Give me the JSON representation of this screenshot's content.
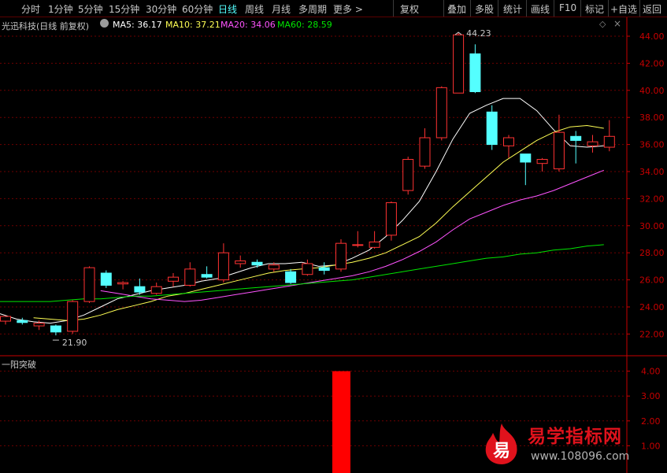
{
  "toolbar": {
    "periods": [
      "分时",
      "1分钟",
      "5分钟",
      "15分钟",
      "30分钟",
      "60分钟",
      "日线",
      "周线",
      "月线",
      "多周期",
      "更多 >"
    ],
    "active_period": "日线",
    "actions": [
      "复权",
      "叠加",
      "多股",
      "统计",
      "画线",
      "F10",
      "标记",
      "+自选",
      "返回"
    ]
  },
  "legend": {
    "stock": "光迅科技(日线 前复权)",
    "ma5": "MA5: 36.17",
    "ma10": "MA10: 37.21",
    "ma20": "MA20: 34.06",
    "ma60": "MA60: 28.59"
  },
  "indicator_title": "一阳突破",
  "watermark": {
    "logo_char": "易",
    "title": "易学指标网",
    "url": "www.108096.com"
  },
  "colors": {
    "up": "#ff3232",
    "down": "#54ffff",
    "ma5": "#ffffff",
    "ma10": "#ffff54",
    "ma20": "#ff54ff",
    "ma60": "#00e600",
    "axis": "#c80000",
    "grid": "#6e0000",
    "signal_bar": "#ff0000"
  },
  "chart_data": [
    {
      "type": "candlestick",
      "title": "光迅科技(日线 前复权)",
      "ylim": [
        21.0,
        45.0
      ],
      "yticks": [
        22.0,
        24.0,
        26.0,
        28.0,
        30.0,
        32.0,
        34.0,
        36.0,
        38.0,
        40.0,
        42.0,
        44.0
      ],
      "candles": [
        {
          "o": 22.95,
          "h": 23.2,
          "l": 22.7,
          "c": 23.3
        },
        {
          "o": 23.0,
          "h": 23.2,
          "l": 22.7,
          "c": 22.85
        },
        {
          "o": 22.6,
          "h": 23.0,
          "l": 22.3,
          "c": 22.8
        },
        {
          "o": 22.6,
          "h": 22.7,
          "l": 21.9,
          "c": 22.15
        },
        {
          "o": 22.2,
          "h": 24.5,
          "l": 22.0,
          "c": 24.4
        },
        {
          "o": 24.4,
          "h": 27.0,
          "l": 24.3,
          "c": 26.9
        },
        {
          "o": 26.5,
          "h": 26.7,
          "l": 25.4,
          "c": 25.6
        },
        {
          "o": 25.7,
          "h": 25.9,
          "l": 25.3,
          "c": 25.8
        },
        {
          "o": 25.5,
          "h": 26.1,
          "l": 24.9,
          "c": 25.1
        },
        {
          "o": 25.0,
          "h": 25.8,
          "l": 24.9,
          "c": 25.5
        },
        {
          "o": 25.9,
          "h": 26.5,
          "l": 25.5,
          "c": 26.2
        },
        {
          "o": 25.6,
          "h": 27.3,
          "l": 25.5,
          "c": 26.8
        },
        {
          "o": 26.4,
          "h": 27.0,
          "l": 26.1,
          "c": 26.2
        },
        {
          "o": 26.0,
          "h": 28.7,
          "l": 25.8,
          "c": 28.0
        },
        {
          "o": 27.2,
          "h": 27.8,
          "l": 26.9,
          "c": 27.4
        },
        {
          "o": 27.3,
          "h": 27.5,
          "l": 26.9,
          "c": 27.1
        },
        {
          "o": 26.8,
          "h": 27.3,
          "l": 26.6,
          "c": 27.1
        },
        {
          "o": 26.6,
          "h": 26.8,
          "l": 25.7,
          "c": 25.8
        },
        {
          "o": 26.4,
          "h": 27.5,
          "l": 26.3,
          "c": 27.2
        },
        {
          "o": 26.9,
          "h": 27.3,
          "l": 26.4,
          "c": 26.7
        },
        {
          "o": 26.8,
          "h": 29.0,
          "l": 26.6,
          "c": 28.7
        },
        {
          "o": 28.6,
          "h": 29.6,
          "l": 28.4,
          "c": 28.6
        },
        {
          "o": 28.4,
          "h": 29.6,
          "l": 28.3,
          "c": 28.8
        },
        {
          "o": 29.3,
          "h": 31.8,
          "l": 28.9,
          "c": 31.7
        },
        {
          "o": 32.6,
          "h": 35.1,
          "l": 32.3,
          "c": 34.9
        },
        {
          "o": 34.4,
          "h": 37.2,
          "l": 34.2,
          "c": 36.5
        },
        {
          "o": 36.5,
          "h": 40.3,
          "l": 36.3,
          "c": 40.2
        },
        {
          "o": 39.8,
          "h": 44.23,
          "l": 39.8,
          "c": 44.1
        },
        {
          "o": 42.7,
          "h": 43.4,
          "l": 39.8,
          "c": 39.9
        },
        {
          "o": 38.4,
          "h": 38.9,
          "l": 35.6,
          "c": 36.0
        },
        {
          "o": 35.9,
          "h": 36.7,
          "l": 35.0,
          "c": 36.5
        },
        {
          "o": 35.3,
          "h": 35.3,
          "l": 33.0,
          "c": 34.7
        },
        {
          "o": 34.6,
          "h": 35.0,
          "l": 34.0,
          "c": 34.9
        },
        {
          "o": 34.2,
          "h": 38.2,
          "l": 34.0,
          "c": 36.9
        },
        {
          "o": 36.6,
          "h": 37.0,
          "l": 34.6,
          "c": 36.3
        },
        {
          "o": 35.9,
          "h": 36.7,
          "l": 35.4,
          "c": 36.2
        },
        {
          "o": 35.8,
          "h": 37.8,
          "l": 35.5,
          "c": 36.6
        }
      ],
      "annotations": [
        {
          "label": "44.23",
          "value": 44.23,
          "candle": 27
        },
        {
          "label": "21.90",
          "value": 21.9,
          "candle": 3
        }
      ],
      "series": [
        {
          "name": "MA5",
          "values": [
            23.5,
            23.1,
            22.9,
            22.8,
            23.0,
            23.4,
            24.0,
            24.6,
            24.9,
            25.2,
            25.4,
            25.6,
            25.9,
            26.1,
            26.5,
            26.9,
            27.2,
            27.2,
            27.3,
            27.0,
            27.1,
            27.6,
            28.2,
            29.2,
            30.4,
            31.8,
            34.0,
            36.4,
            38.3,
            38.9,
            39.4,
            39.4,
            38.5,
            37.1,
            35.9,
            35.8,
            35.9
          ]
        },
        {
          "name": "MA10",
          "values": [
            null,
            null,
            23.2,
            23.1,
            23.0,
            23.1,
            23.4,
            23.8,
            24.1,
            24.4,
            24.8,
            25.0,
            25.3,
            25.6,
            25.9,
            26.2,
            26.5,
            26.7,
            26.8,
            26.9,
            27.1,
            27.3,
            27.6,
            28.0,
            28.6,
            29.2,
            30.2,
            31.4,
            32.5,
            33.6,
            34.7,
            35.5,
            36.3,
            36.9,
            37.3,
            37.4,
            37.2
          ]
        },
        {
          "name": "MA20",
          "values": [
            null,
            null,
            null,
            null,
            null,
            null,
            25.2,
            25.0,
            24.8,
            24.6,
            24.5,
            24.4,
            24.5,
            24.7,
            24.9,
            25.1,
            25.3,
            25.5,
            25.7,
            25.9,
            26.1,
            26.3,
            26.6,
            27.0,
            27.5,
            28.1,
            28.8,
            29.7,
            30.5,
            31.0,
            31.5,
            31.9,
            32.2,
            32.6,
            33.1,
            33.6,
            34.1
          ]
        },
        {
          "name": "MA60",
          "values": [
            24.4,
            24.4,
            24.4,
            24.4,
            24.5,
            24.6,
            24.6,
            24.7,
            24.8,
            24.8,
            24.9,
            25.0,
            25.1,
            25.2,
            25.3,
            25.4,
            25.5,
            25.6,
            25.7,
            25.8,
            25.9,
            26.0,
            26.2,
            26.4,
            26.6,
            26.8,
            27.0,
            27.2,
            27.4,
            27.6,
            27.7,
            27.9,
            28.0,
            28.2,
            28.3,
            28.5,
            28.6
          ]
        }
      ]
    },
    {
      "type": "bar",
      "title": "一阳突破",
      "ylim": [
        0,
        4.6
      ],
      "yticks": [
        1.0,
        2.0,
        3.0,
        4.0
      ],
      "values": [
        0,
        0,
        0,
        0,
        0,
        0,
        0,
        0,
        0,
        0,
        0,
        0,
        0,
        0,
        0,
        0,
        0,
        0,
        0,
        0,
        4.0,
        0,
        0,
        0,
        0,
        0,
        0,
        0,
        0,
        0,
        0,
        0,
        0,
        0,
        0,
        0,
        0
      ]
    }
  ]
}
